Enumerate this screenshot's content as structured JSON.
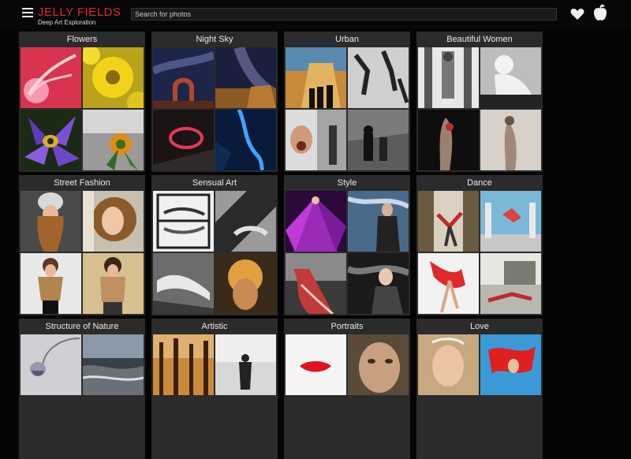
{
  "header": {
    "brand_title": "JELLY FIELDS",
    "brand_subtitle": "Deep Art Exploration",
    "search_placeholder": "Search for photos",
    "icons": [
      "menu-icon",
      "heart-icon",
      "apple-icon"
    ],
    "accent_color": "#e0262b"
  },
  "categories": [
    {
      "title": "Flowers"
    },
    {
      "title": "Night Sky"
    },
    {
      "title": "Urban"
    },
    {
      "title": "Beautiful Women"
    },
    {
      "title": "Street Fashion"
    },
    {
      "title": "Sensual Art"
    },
    {
      "title": "Style"
    },
    {
      "title": "Dance"
    },
    {
      "title": "Structure of Nature"
    },
    {
      "title": "Artistic"
    },
    {
      "title": "Portraits"
    },
    {
      "title": "Love"
    }
  ]
}
